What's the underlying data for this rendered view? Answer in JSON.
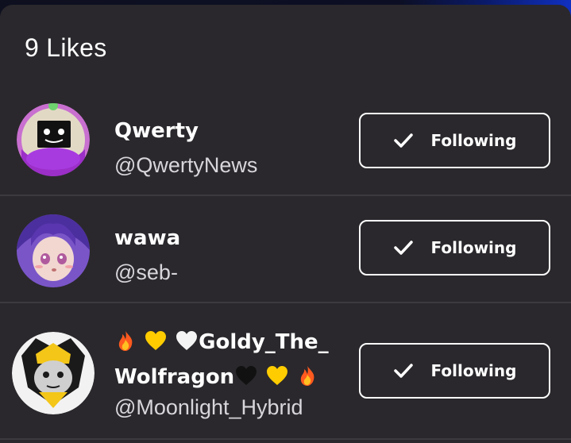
{
  "sheet": {
    "title": "9 Likes"
  },
  "users": [
    {
      "display_name": "Qwerty",
      "handle": "@QwertyNews",
      "button_label": "Following",
      "avatar_icon": "computer-face-avatar"
    },
    {
      "display_name": "wawa",
      "handle": "@seb-",
      "button_label": "Following",
      "avatar_icon": "purple-hair-girl-avatar"
    },
    {
      "name_part_1": "Goldy_The_",
      "name_part_2": "Wolfragon",
      "name_emojis_before": [
        "fire-icon",
        "yellow-heart-icon",
        "white-heart-icon"
      ],
      "name_emojis_after": [
        "black-heart-icon",
        "yellow-heart-icon",
        "fire-icon"
      ],
      "handle": "@Moonlight_Hybrid",
      "button_label": "Following",
      "avatar_icon": "wolf-dragon-avatar"
    }
  ],
  "colors": {
    "sheet_bg": "#2a282c",
    "divider": "#3c3a3f",
    "button_border": "#ffffff",
    "text_primary": "#ffffff",
    "text_secondary": "#d8d6db"
  }
}
